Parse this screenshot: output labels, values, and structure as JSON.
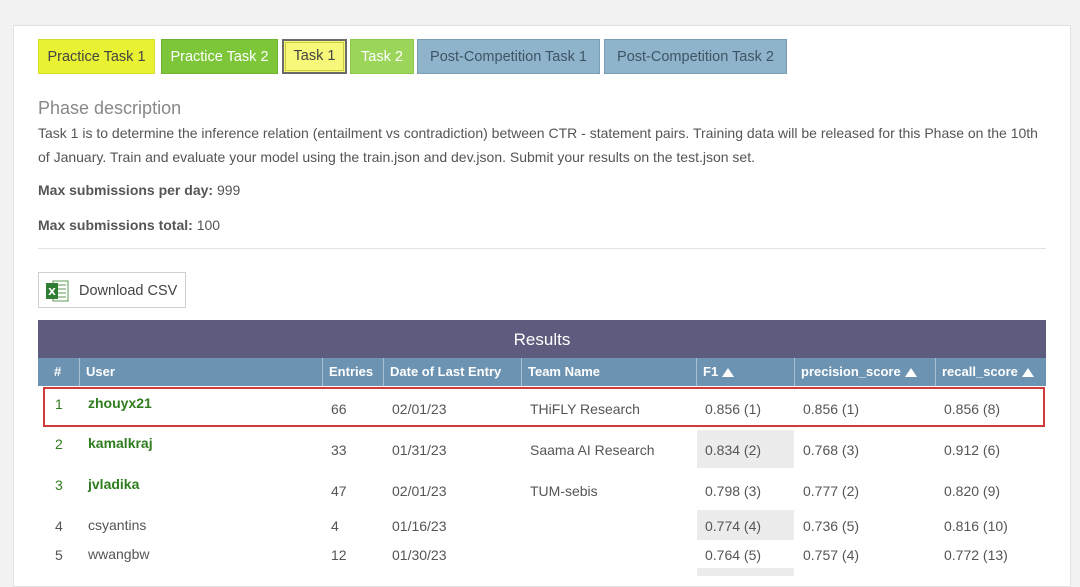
{
  "tabs": [
    {
      "label": "Practice Task 1"
    },
    {
      "label": "Practice Task 2"
    },
    {
      "label": "Task 1"
    },
    {
      "label": "Task 2"
    },
    {
      "label": "Post-Competition Task 1"
    },
    {
      "label": "Post-Competition Task 2"
    }
  ],
  "phase": {
    "title": "Phase description",
    "description": "Task 1 is to determine the inference relation (entailment vs contradiction) between CTR - statement pairs. Training data will be released for this Phase on the 10th of January. Train and evaluate your model using the train.json and dev.json. Submit your results on the test.json set.",
    "max_per_day_label": "Max submissions per day:",
    "max_per_day_value": "999",
    "max_total_label": "Max submissions total:",
    "max_total_value": "100"
  },
  "download": {
    "label": "Download CSV",
    "icon": "excel-icon"
  },
  "results": {
    "title": "Results",
    "columns": [
      "#",
      "User",
      "Entries",
      "Date of Last Entry",
      "Team Name",
      "F1",
      "precision_score",
      "recall_score"
    ],
    "rows": [
      {
        "rank": "1",
        "user": "zhouyx21",
        "entries": "66",
        "date": "02/01/23",
        "team": "THiFLY Research",
        "f1": "0.856 (1)",
        "precision": "0.856 (1)",
        "recall": "0.856 (8)"
      },
      {
        "rank": "2",
        "user": "kamalkraj",
        "entries": "33",
        "date": "01/31/23",
        "team": "Saama AI Research",
        "f1": "0.834 (2)",
        "precision": "0.768 (3)",
        "recall": "0.912 (6)"
      },
      {
        "rank": "3",
        "user": "jvladika",
        "entries": "47",
        "date": "02/01/23",
        "team": "TUM-sebis",
        "f1": "0.798 (3)",
        "precision": "0.777 (2)",
        "recall": "0.820 (9)"
      },
      {
        "rank": "4",
        "user": "csyantins",
        "entries": "4",
        "date": "01/16/23",
        "team": "",
        "f1": "0.774 (4)",
        "precision": "0.736 (5)",
        "recall": "0.816 (10)"
      },
      {
        "rank": "5",
        "user": "wwangbw",
        "entries": "12",
        "date": "01/30/23",
        "team": "",
        "f1": "0.764 (5)",
        "precision": "0.757 (4)",
        "recall": "0.772 (13)"
      }
    ]
  },
  "colors": {
    "results_bar": "#5e5c7e",
    "header_row": "#6c93b2",
    "highlight": "#d23a3a",
    "user_link": "#2f7d1f"
  }
}
